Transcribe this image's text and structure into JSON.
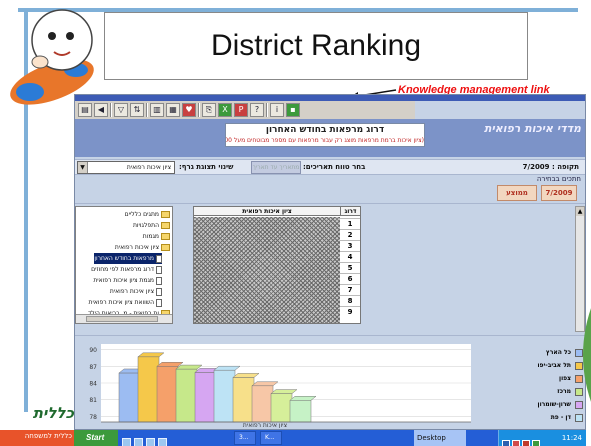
{
  "slide": {
    "title": "District Ranking",
    "annotation": "Knowledge management link"
  },
  "app": {
    "brand": "מדדי איכות רפואית",
    "subtitle_line1": "דרוג מרפאות בחודש האחרון",
    "subtitle_line2": "(ציון איכות ברמת מרפאות מוצג רק עבור מרפאות עם מספר מבוטחים מעל 300)",
    "toolbar_icons": [
      "print-icon",
      "back-icon",
      "filter-icon",
      "sort-icon",
      "chart-icon",
      "table-icon",
      "heart-icon",
      "export-icon",
      "excel-icon",
      "pdf-icon",
      "help-icon",
      "info-icon",
      "green-link-icon"
    ],
    "filters": {
      "period_label": "תקופה :",
      "period_value": "7/2009",
      "range_label": "בחר טווח תאריכים:",
      "range_button": "מתאריך עד תאריך",
      "graph_label": "שינוי תצוגת גרף:",
      "graph_select": "ציון איכות רפואית"
    },
    "selected_caption": "חתכים בבחירה",
    "tabs": [
      {
        "label": "7/2009"
      },
      {
        "label": "ממוצע"
      }
    ],
    "tree": {
      "items": [
        {
          "label": "מתגים כלליים",
          "kind": "folder",
          "selected": false
        },
        {
          "label": "התפלגויות",
          "kind": "folder",
          "selected": false
        },
        {
          "label": "מגמות",
          "kind": "folder",
          "selected": false
        },
        {
          "label": "ציון איכות רפואית",
          "kind": "folder",
          "selected": false
        },
        {
          "label": "מרפאות בחודש האחרון",
          "kind": "doc",
          "selected": true
        },
        {
          "label": "דרוג מרפאות לפי מחוזים",
          "kind": "doc",
          "selected": false
        },
        {
          "label": "מגמת ציון איכות רפואית",
          "kind": "doc",
          "selected": false
        },
        {
          "label": "ציון איכות רפואית",
          "kind": "doc",
          "selected": false
        },
        {
          "label": "השוואת ציון איכות רפואית",
          "kind": "doc",
          "selected": false
        },
        {
          "label": "ות רפואית - מ. בריאות הילד",
          "kind": "folder",
          "selected": false
        }
      ]
    },
    "rank_table": {
      "col_rank": "דרוג",
      "col_score": "ציון איכות רפואית",
      "ranks": [
        "1",
        "2",
        "3",
        "4",
        "5",
        "6",
        "7",
        "8",
        "9"
      ]
    },
    "chart": {
      "xlabel": "ציון איכות רפואית",
      "y_ticks": [
        "90",
        "87",
        "84",
        "81",
        "78"
      ]
    }
  },
  "chart_data": {
    "type": "bar",
    "categories": [
      "כל הארץ",
      "תל אביב-יפו",
      "צפון",
      "מרכז",
      "שרון-שומרון",
      "דן - פת",
      "",
      "",
      "",
      ""
    ],
    "values": [
      85.8,
      88.7,
      87.0,
      86.5,
      85.9,
      86.3,
      85.0,
      83.5,
      82.1,
      80.9
    ],
    "colors": [
      "#9cbcf2",
      "#f5c84a",
      "#f5a06a",
      "#c6e88a",
      "#d6a6f2",
      "#bde3f5",
      "#f7e08a",
      "#f7c7a7",
      "#d6ef9a",
      "#c6f2c6"
    ],
    "legend": [
      {
        "label": "כל הארץ",
        "color": "#9cbcf2"
      },
      {
        "label": "תל אביב-יפו",
        "color": "#f5c84a"
      },
      {
        "label": "צפון",
        "color": "#f5a06a"
      },
      {
        "label": "מרכז",
        "color": "#c6e88a"
      },
      {
        "label": "שרון-שומרון",
        "color": "#d6a6f2"
      },
      {
        "label": "דן - פת",
        "color": "#bde3f5"
      }
    ],
    "yticks": [
      90,
      87,
      84,
      81,
      78
    ],
    "ylim": [
      77,
      91
    ],
    "grid": true,
    "legend_position": "right"
  },
  "taskbar": {
    "start": "Start",
    "items": [
      "",
      "3...",
      "K..."
    ],
    "desktop": "Desktop",
    "clock": "11:24"
  },
  "logo": {
    "text": "כללית",
    "subtitle": "כללית למשפחה"
  }
}
